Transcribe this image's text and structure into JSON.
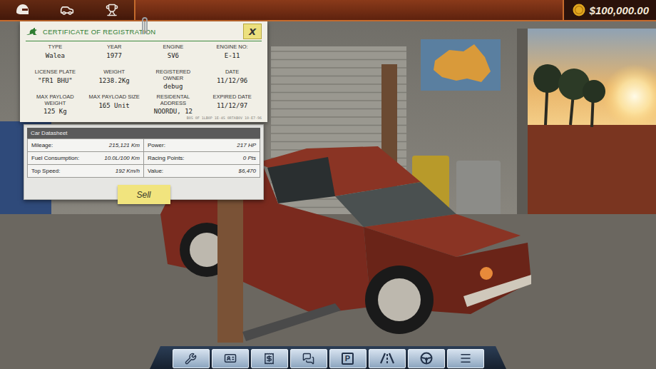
{
  "top_bar": {
    "money": "$100,000.00"
  },
  "certificate": {
    "title": "CERTIFICATE OF REGISTRATION",
    "close": "X",
    "fields": [
      {
        "label": "TYPE",
        "value": "Walea"
      },
      {
        "label": "YEAR",
        "value": "1977"
      },
      {
        "label": "ENGINE",
        "value": "SV6"
      },
      {
        "label": "ENGINE NO:",
        "value": "E-11"
      },
      {
        "label": "LICENSE PLATE",
        "value": "\"FR1 BHU\""
      },
      {
        "label": "WEIGHT",
        "value": "1238.2Kg"
      },
      {
        "label": "REGISTERED OWNER",
        "value": "debug"
      },
      {
        "label": "DATE",
        "value": "11/12/96"
      },
      {
        "label": "MAX PAYLOAD WEIGHT",
        "value": "125 Kg"
      },
      {
        "label": "MAX PAYLOAD SIZE",
        "value": "165 Unit"
      },
      {
        "label": "RESIDENTAL ADDRESS",
        "value": "NOORDU, 12"
      },
      {
        "label": "EXPIRED DATE",
        "value": "11/12/97"
      }
    ],
    "fine_print": "B0S 0F 1LB0P 1E-4S 0RTAB0V 10-E7-96"
  },
  "datasheet": {
    "title": "Car Datasheet",
    "rows": [
      {
        "label": "Mileage:",
        "value": "215,121 Km"
      },
      {
        "label": "Power:",
        "value": "217 HP"
      },
      {
        "label": "Fuel Consumption:",
        "value": "10.0L/100 Km"
      },
      {
        "label": "Racing Points:",
        "value": "0 Pts"
      },
      {
        "label": "Top Speed:",
        "value": "192 Km/h"
      },
      {
        "label": "Value:",
        "value": "$6,470"
      }
    ],
    "sell_button": "Sell"
  },
  "toolbar": {
    "parking_label": "P"
  }
}
